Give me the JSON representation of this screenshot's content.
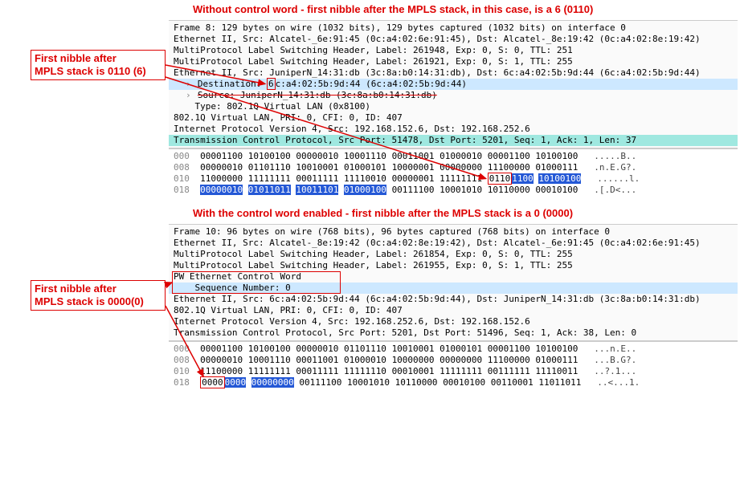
{
  "section1": {
    "title": "Without control word - first nibble after the MPLS stack, in this case, is a 6 (0110)",
    "caption": "First nibble after\nMPLS stack is 0110 (6)",
    "rows": [
      {
        "text": "Frame 8: 129 bytes on wire (1032 bits), 129 bytes captured (1032 bits) on interface 0"
      },
      {
        "text": "Ethernet II, Src: Alcatel-_6e:91:45 (0c:a4:02:6e:91:45), Dst: Alcatel-_8e:19:42 (0c:a4:02:8e:19:42)"
      },
      {
        "text": "MultiProtocol Label Switching Header, Label: 261948, Exp: 0, S: 0, TTL: 251"
      },
      {
        "text": "MultiProtocol Label Switching Header, Label: 261921, Exp: 0, S: 1, TTL: 255"
      },
      {
        "text": "Ethernet II, Src: JuniperN_14:31:db (3c:8a:b0:14:31:db), Dst: 6c:a4:02:5b:9d:44 (6c:a4:02:5b:9d:44)"
      },
      {
        "indent": 2,
        "expander": "›",
        "prefix": "Destination: ",
        "boxed": "6",
        "suffix": "c:a4:02:5b:9d:44 (6c:a4:02:5b:9d:44)",
        "sel": "blue"
      },
      {
        "indent": 2,
        "expander": "›",
        "text": "Source: JuniperN_14:31:db (3c:8a:b0:14:31:db)",
        "strike": true
      },
      {
        "indent": 4,
        "text": "Type: 802.1Q Virtual LAN (0x8100)"
      },
      {
        "text": "802.1Q Virtual LAN, PRI: 0, CFI: 0, ID: 407"
      },
      {
        "text": "Internet Protocol Version 4, Src: 192.168.152.6, Dst: 192.168.252.6"
      },
      {
        "text": "Transmission Control Protocol, Src Port: 51478, Dst Port: 5201, Seq: 1, Ack: 1, Len: 37",
        "sel": "teal"
      }
    ],
    "hex": [
      {
        "off": "000",
        "bits": [
          "00001100",
          "10100100",
          "00000010",
          "10001110",
          "00011001",
          "01000010",
          "00001100",
          "10100100"
        ],
        "asc": ".....B.."
      },
      {
        "off": "008",
        "bits": [
          "00000010",
          "01101110",
          "10010001",
          "01000101",
          "10000001",
          "00000000",
          "11100000",
          "01000111"
        ],
        "asc": ".n.E.G?."
      },
      {
        "off": "010",
        "bits": [
          "11000000",
          "11111111",
          "00011111",
          "11110010",
          "00000001",
          "11111111"
        ],
        "tail_box": "0110",
        "tail_hi": [
          "1100",
          "10100100"
        ],
        "asc": "......l."
      },
      {
        "off": "018",
        "bits_hi": [
          "00000010",
          "01011011",
          "10011101",
          "01000100"
        ],
        "bits": [
          "00111100",
          "10001010",
          "10110000",
          "00010100"
        ],
        "asc": ".[.D<..."
      }
    ]
  },
  "section2": {
    "title": "With the control word enabled - first nibble after the MPLS stack is a 0 (0000)",
    "caption": "First nibble after\nMPLS stack is 0000(0)",
    "rows": [
      {
        "text": "Frame 10: 96 bytes on wire (768 bits), 96 bytes captured (768 bits) on interface 0"
      },
      {
        "text": "Ethernet II, Src: Alcatel-_8e:19:42 (0c:a4:02:8e:19:42), Dst: Alcatel-_6e:91:45 (0c:a4:02:6e:91:45)"
      },
      {
        "text": "MultiProtocol Label Switching Header, Label: 261854, Exp: 0, S: 0, TTL: 255"
      },
      {
        "text": "MultiProtocol Label Switching Header, Label: 261955, Exp: 0, S: 1, TTL: 255"
      },
      {
        "text": "PW Ethernet Control Word",
        "box": true
      },
      {
        "indent": 4,
        "text": "Sequence Number: 0",
        "box": true,
        "sel": "blue"
      },
      {
        "text": "Ethernet II, Src: 6c:a4:02:5b:9d:44 (6c:a4:02:5b:9d:44), Dst: JuniperN_14:31:db (3c:8a:b0:14:31:db)"
      },
      {
        "text": "802.1Q Virtual LAN, PRI: 0, CFI: 0, ID: 407"
      },
      {
        "text": "Internet Protocol Version 4, Src: 192.168.252.6, Dst: 192.168.152.6"
      },
      {
        "text": "Transmission Control Protocol, Src Port: 5201, Dst Port: 51496, Seq: 1, Ack: 38, Len: 0"
      }
    ],
    "hex": [
      {
        "off": "000",
        "bits": [
          "00001100",
          "10100100",
          "00000010",
          "01101110",
          "10010001",
          "01000101",
          "00001100",
          "10100100"
        ],
        "asc": "...n.E.."
      },
      {
        "off": "008",
        "bits": [
          "00000010",
          "10001110",
          "00011001",
          "01000010",
          "10000000",
          "00000000",
          "11100000",
          "01000111"
        ],
        "asc": "...B.G?."
      },
      {
        "off": "010",
        "bits": [
          "11100000",
          "11111111",
          "00011111",
          "11111110",
          "00010001",
          "11111111",
          "00111111",
          "11110011"
        ],
        "asc": "..?.1..."
      },
      {
        "off": "018",
        "head_box": "0000",
        "head_hi": [
          "0000",
          "00000000"
        ],
        "bits": [
          "00111100",
          "10001010",
          "10110000",
          "00010100",
          "00110001",
          "11011011"
        ],
        "asc": "..<...1."
      }
    ]
  }
}
